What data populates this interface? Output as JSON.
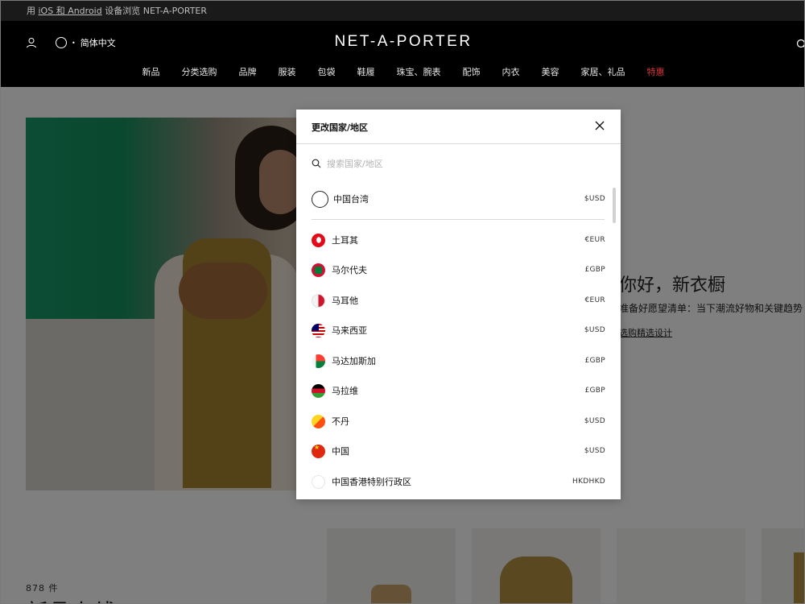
{
  "promo": {
    "prefix": "用 ",
    "link": "iOS 和 Android",
    "suffix": " 设备浏览 NET-A-PORTER"
  },
  "header": {
    "language": "简体中文",
    "logo": "NET-A-PORTER",
    "nav": [
      "新品",
      "分类选购",
      "品牌",
      "服装",
      "包袋",
      "鞋履",
      "珠宝、腕表",
      "配饰",
      "内衣",
      "美容",
      "家居、礼品",
      "特惠"
    ],
    "sale_color": "#d83a3a"
  },
  "hero": {
    "title": "你好，新衣橱",
    "subtitle": "准备好愿望清单：当下潮流好物和关键趋势",
    "link": "选购精选设计"
  },
  "listing": {
    "count": "878 件",
    "heading": "新品上线"
  },
  "modal": {
    "title": "更改国家/地区",
    "search_placeholder": "搜索国家/地区",
    "selected": {
      "name": "中国台湾",
      "currency": "$USD"
    },
    "countries": [
      {
        "name": "土耳其",
        "currency": "€EUR",
        "flag": "flag-tr"
      },
      {
        "name": "马尔代夫",
        "currency": "£GBP",
        "flag": "flag-mv"
      },
      {
        "name": "马耳他",
        "currency": "€EUR",
        "flag": "flag-mt"
      },
      {
        "name": "马来西亚",
        "currency": "$USD",
        "flag": "flag-my"
      },
      {
        "name": "马达加斯加",
        "currency": "£GBP",
        "flag": "flag-mg"
      },
      {
        "name": "马拉维",
        "currency": "£GBP",
        "flag": "flag-mw"
      },
      {
        "name": "不丹",
        "currency": "$USD",
        "flag": "flag-bt"
      },
      {
        "name": "中国",
        "currency": "$USD",
        "flag": "flag-cn"
      },
      {
        "name": "中国香港特别行政区",
        "currency": "HKDHKD",
        "flag": "flag-hk"
      }
    ]
  }
}
